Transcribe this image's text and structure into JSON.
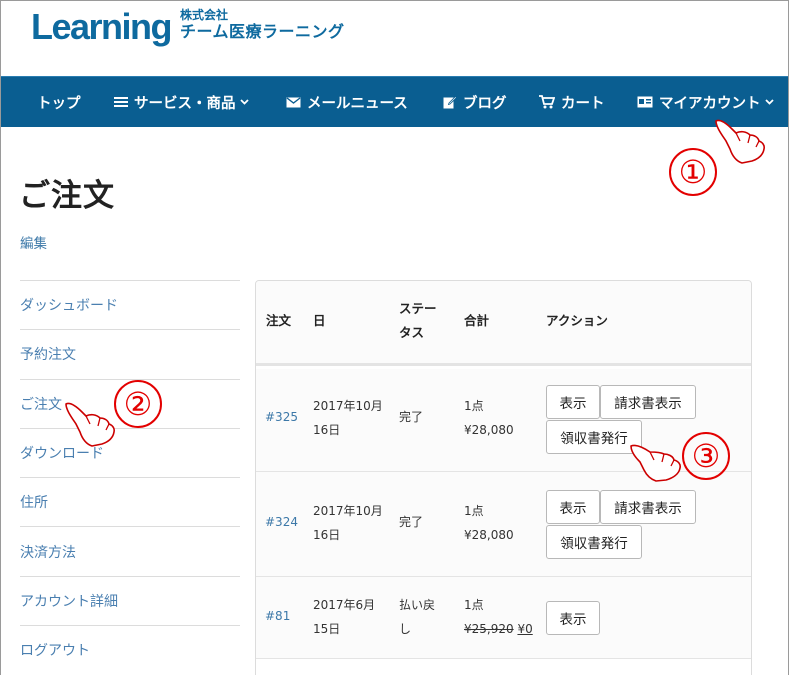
{
  "logo": {
    "word": "Learning",
    "company_line1": "株式会社",
    "company_line2": "チーム医療ラーニング"
  },
  "nav": {
    "items": [
      {
        "label": "トップ"
      },
      {
        "label": "サービス・商品",
        "icon": "menu-icon",
        "dropdown": true
      },
      {
        "label": "メールニュース",
        "icon": "envelope-icon"
      },
      {
        "label": "ブログ",
        "icon": "edit-icon"
      },
      {
        "label": "カート",
        "icon": "cart-icon"
      },
      {
        "label": "マイアカウント",
        "icon": "id-card-icon",
        "dropdown": true
      }
    ]
  },
  "page": {
    "title": "ご注文",
    "edit_link": "編集"
  },
  "sidebar": {
    "items": [
      {
        "label": "ダッシュボード"
      },
      {
        "label": "予約注文"
      },
      {
        "label": "ご注文"
      },
      {
        "label": "ダウンロード"
      },
      {
        "label": "住所"
      },
      {
        "label": "決済方法"
      },
      {
        "label": "アカウント詳細"
      },
      {
        "label": "ログアウト"
      }
    ]
  },
  "orders": {
    "headers": {
      "order": "注文",
      "date": "日",
      "status_1": "ステー",
      "status_2": "タス",
      "total": "合計",
      "action": "アクション"
    },
    "rows": [
      {
        "number": "#325",
        "date_1": "2017年10月",
        "date_2": "16日",
        "status_1": "完了",
        "status_2": "",
        "qty": "1点",
        "price": "¥28,080",
        "old_price": "",
        "new_price": "",
        "btn_view": "表示",
        "btn_invoice": "請求書表示",
        "btn_receipt": "領収書発行"
      },
      {
        "number": "#324",
        "date_1": "2017年10月",
        "date_2": "16日",
        "status_1": "完了",
        "status_2": "",
        "qty": "1点",
        "price": "¥28,080",
        "old_price": "",
        "new_price": "",
        "btn_view": "表示",
        "btn_invoice": "請求書表示",
        "btn_receipt": "領収書発行"
      },
      {
        "number": "#81",
        "date_1": "2017年6月",
        "date_2": "15日",
        "status_1": "払い戻",
        "status_2": "し",
        "qty": "1点",
        "price": "",
        "old_price": "¥25,920",
        "new_price": "¥0",
        "btn_view": "表示",
        "btn_invoice": "",
        "btn_receipt": ""
      }
    ]
  },
  "annotations": {
    "one": "①",
    "two": "②",
    "three": "③"
  },
  "colors": {
    "brand": "#0e6a9f",
    "nav_bg": "#0a5e91",
    "link": "#3c78a8",
    "annotation": "#e30000"
  }
}
